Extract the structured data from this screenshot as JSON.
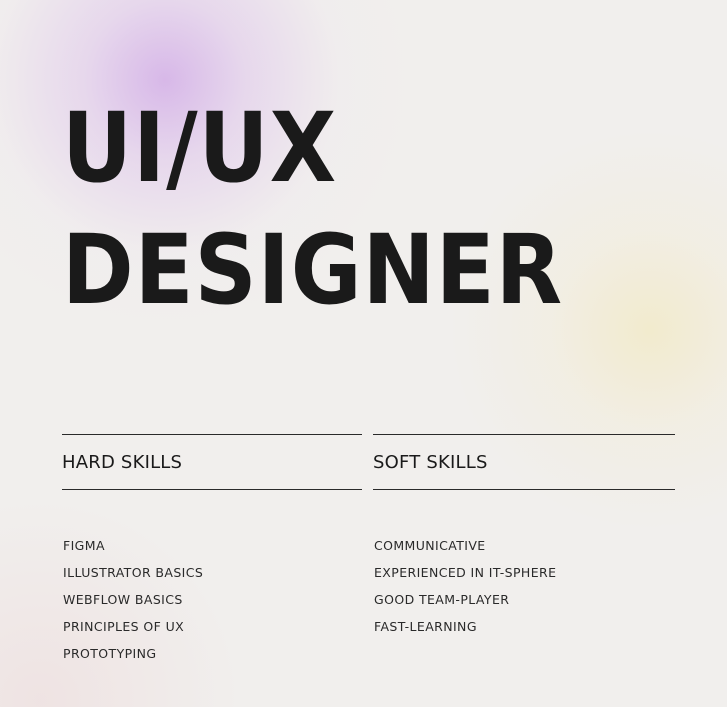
{
  "title": {
    "line1": "UI/UX",
    "line2": "DESIGNER"
  },
  "hard_skills": {
    "heading": "HARD SKILLS",
    "items": [
      "FIGMA",
      "ILLUSTRATOR BASICS",
      "WEBFLOW BASICS",
      "PRINCIPLES OF UX",
      "PROTOTYPING"
    ]
  },
  "soft_skills": {
    "heading": "SOFT SKILLS",
    "items": [
      "COMMUNICATIVE",
      "EXPERIENCED IN IT-SPHERE",
      "GOOD TEAM-PLAYER",
      "FAST-LEARNING"
    ]
  },
  "colors": {
    "text": "#1a1a1a",
    "background": "#f1efed",
    "accent_purple": "#d6b5e8",
    "accent_yellow": "#f2eac8"
  }
}
